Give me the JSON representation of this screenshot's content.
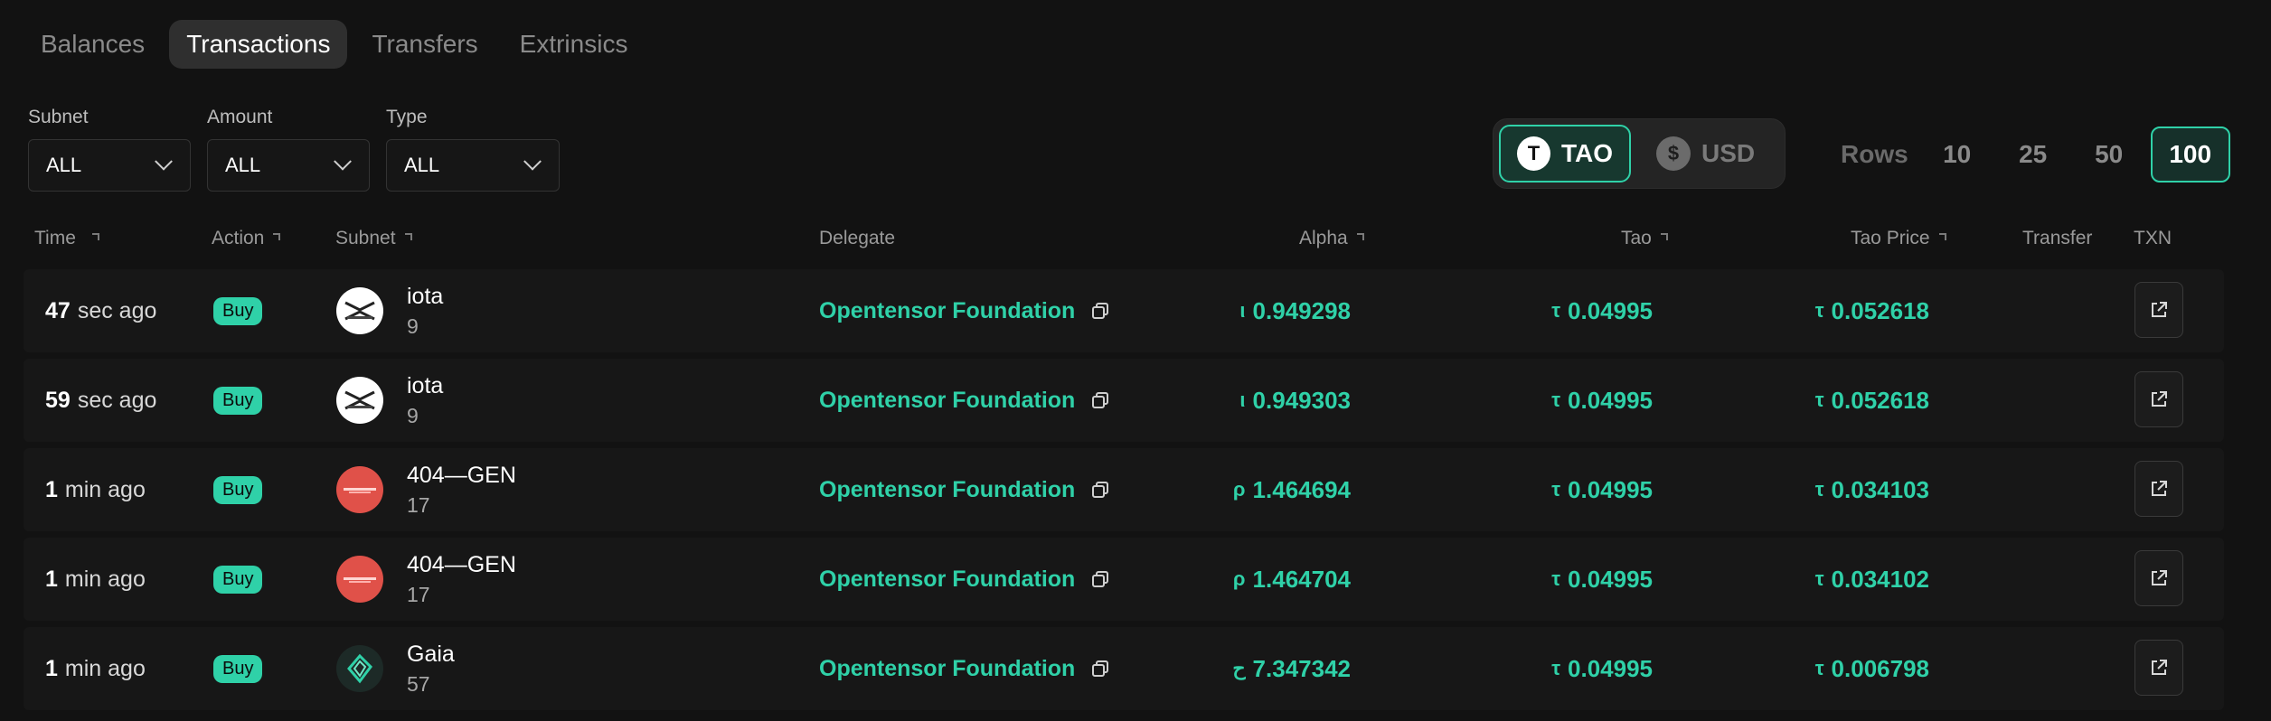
{
  "tabs": [
    {
      "label": "Balances",
      "active": false
    },
    {
      "label": "Transactions",
      "active": true
    },
    {
      "label": "Transfers",
      "active": false
    },
    {
      "label": "Extrinsics",
      "active": false
    }
  ],
  "filters": {
    "subnet": {
      "label": "Subnet",
      "value": "ALL"
    },
    "amount": {
      "label": "Amount",
      "value": "ALL"
    },
    "type": {
      "label": "Type",
      "value": "ALL"
    }
  },
  "currency": {
    "tao": {
      "label": "TAO",
      "icon": "T",
      "active": true
    },
    "usd": {
      "label": "USD",
      "icon": "$",
      "active": false
    }
  },
  "rows_selector": {
    "label": "Rows",
    "options": [
      "10",
      "25",
      "50",
      "100"
    ],
    "selected": "100"
  },
  "columns": {
    "time": "Time",
    "action": "Action",
    "subnet": "Subnet",
    "delegate": "Delegate",
    "alpha": "Alpha",
    "tao": "Tao",
    "tao_price": "Tao Price",
    "transfer": "Transfer",
    "txn": "TXN"
  },
  "transactions": [
    {
      "time_num": "47",
      "time_unit": "sec ago",
      "action": "Buy",
      "subnet_name": "iota",
      "subnet_id": "9",
      "logo": "iota",
      "delegate": "Opentensor Foundation",
      "alpha_symbol": "ι",
      "alpha": "0.949298",
      "tao_symbol": "τ",
      "tao": "0.04995",
      "price_symbol": "τ",
      "price": "0.052618"
    },
    {
      "time_num": "59",
      "time_unit": "sec ago",
      "action": "Buy",
      "subnet_name": "iota",
      "subnet_id": "9",
      "logo": "iota",
      "delegate": "Opentensor Foundation",
      "alpha_symbol": "ι",
      "alpha": "0.949303",
      "tao_symbol": "τ",
      "tao": "0.04995",
      "price_symbol": "τ",
      "price": "0.052618"
    },
    {
      "time_num": "1",
      "time_unit": "min ago",
      "action": "Buy",
      "subnet_name": "404—GEN",
      "subnet_id": "17",
      "logo": "gen",
      "delegate": "Opentensor Foundation",
      "alpha_symbol": "ρ",
      "alpha": "1.464694",
      "tao_symbol": "τ",
      "tao": "0.04995",
      "price_symbol": "τ",
      "price": "0.034103"
    },
    {
      "time_num": "1",
      "time_unit": "min ago",
      "action": "Buy",
      "subnet_name": "404—GEN",
      "subnet_id": "17",
      "logo": "gen",
      "delegate": "Opentensor Foundation",
      "alpha_symbol": "ρ",
      "alpha": "1.464704",
      "tao_symbol": "τ",
      "tao": "0.04995",
      "price_symbol": "τ",
      "price": "0.034102"
    },
    {
      "time_num": "1",
      "time_unit": "min ago",
      "action": "Buy",
      "subnet_name": "Gaia",
      "subnet_id": "57",
      "logo": "gaia",
      "delegate": "Opentensor Foundation",
      "alpha_symbol": "ح",
      "alpha": "7.347342",
      "tao_symbol": "τ",
      "tao": "0.04995",
      "price_symbol": "τ",
      "price": "0.006798"
    }
  ]
}
